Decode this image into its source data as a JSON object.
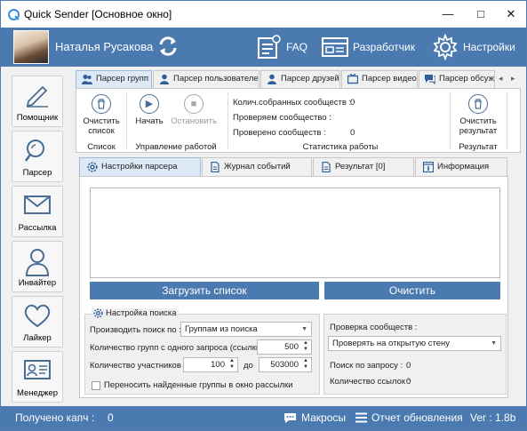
{
  "window": {
    "title": "Quick Sender [Основное окно]",
    "min": "—",
    "max": "□",
    "close": "✕"
  },
  "header": {
    "user_name": "Наталья Русакова",
    "faq": "FAQ",
    "developer": "Разработчик",
    "settings": "Настройки"
  },
  "sidebar": [
    {
      "label": "Помощник",
      "icon": "pencil-icon"
    },
    {
      "label": "Парсер",
      "icon": "magnifier-icon"
    },
    {
      "label": "Рассылка",
      "icon": "envelope-icon"
    },
    {
      "label": "Инвайтер",
      "icon": "person-icon"
    },
    {
      "label": "Лайкер",
      "icon": "heart-icon"
    },
    {
      "label": "Менеджер",
      "icon": "id-card-icon"
    }
  ],
  "top_tabs": [
    {
      "label": "Парсер групп"
    },
    {
      "label": "Парсер пользователей"
    },
    {
      "label": "Парсер друзей"
    },
    {
      "label": "Парсер видео"
    },
    {
      "label": "Парсер обсужд"
    }
  ],
  "ribbon": {
    "clear_list": "Очистить\nсписок",
    "clear_list_l1": "Очистить",
    "clear_list_l2": "список",
    "group_list": "Список",
    "start": "Начать",
    "stop": "Остановить",
    "group_control": "Управление работой",
    "stats": [
      {
        "label": "Колич.собранных сообществ :",
        "value": "0"
      },
      {
        "label": "Проверяем сообщество :",
        "value": ""
      },
      {
        "label": "Проверено сообществ :",
        "value": "0"
      }
    ],
    "group_stats": "Статистика работы",
    "clear_result_l1": "Очистить",
    "clear_result_l2": "результат",
    "group_result": "Результат"
  },
  "inner_tabs": [
    {
      "label": "Настройки парсера"
    },
    {
      "label": "Журнал событий"
    },
    {
      "label": "Результат [0]"
    },
    {
      "label": "Информация"
    }
  ],
  "buttons": {
    "load_list": "Загрузить список",
    "clear": "Очистить"
  },
  "search_settings": {
    "title": "Настройка поиска",
    "search_by_label": "Производить поиск по :",
    "search_by_value": "Группам из поиска",
    "groups_per_request_label": "Количество групп с одного запроса (ссылки ):",
    "groups_per_request_value": "500",
    "members_label": "Количество участников :",
    "members_from": "100",
    "members_to_label": "до",
    "members_to": "503000",
    "transfer_checkbox_label": "Переносить найденные группы в окно рассылки",
    "transfer_checked": false
  },
  "check_settings": {
    "check_label": "Проверка сообществ :",
    "check_value": "Проверять на открытую стену",
    "by_request_label": "Поиск по запросу :",
    "by_request_value": "0",
    "links_count_label": "Количество ссылок :",
    "links_count_value": "0"
  },
  "statusbar": {
    "captcha_label": "Получено капч :",
    "captcha_value": "0",
    "macros": "Макросы",
    "update_report": "Отчет обновления",
    "version": "Ver : 1.8b"
  },
  "colors": {
    "accent": "#4a7ab0",
    "active_tab": "#dde9f7"
  }
}
